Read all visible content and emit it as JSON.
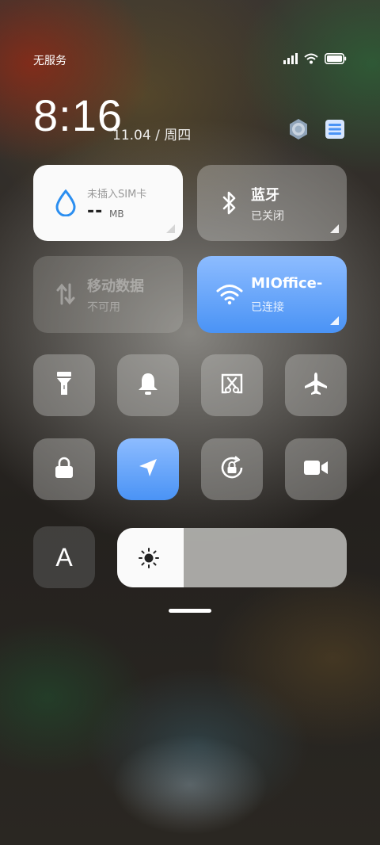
{
  "status_bar": {
    "carrier": "无服务"
  },
  "clock": {
    "time": "8:16",
    "date": "11.04 / 周四"
  },
  "tiles": {
    "sim": {
      "label": "未插入SIM卡",
      "value": "--",
      "unit": "MB"
    },
    "bluetooth": {
      "title": "蓝牙",
      "subtitle": "已关闭"
    },
    "mobile_data": {
      "title": "移动数据",
      "subtitle": "不可用"
    },
    "wifi": {
      "title": "MIOffice-",
      "subtitle": "已连接"
    }
  },
  "quick_toggles_row1": [
    "flashlight-icon",
    "bell-icon",
    "screenshot-cut-icon",
    "airplane-icon"
  ],
  "quick_toggles_row2": [
    "lock-icon",
    "location-icon",
    "rotation-lock-icon",
    "video-camera-icon"
  ],
  "font_tile": {
    "label": "A"
  },
  "brightness": {
    "level": 0.29
  },
  "colors": {
    "accent_blue": "#4a93f5",
    "tile_light": "#fafafa"
  }
}
